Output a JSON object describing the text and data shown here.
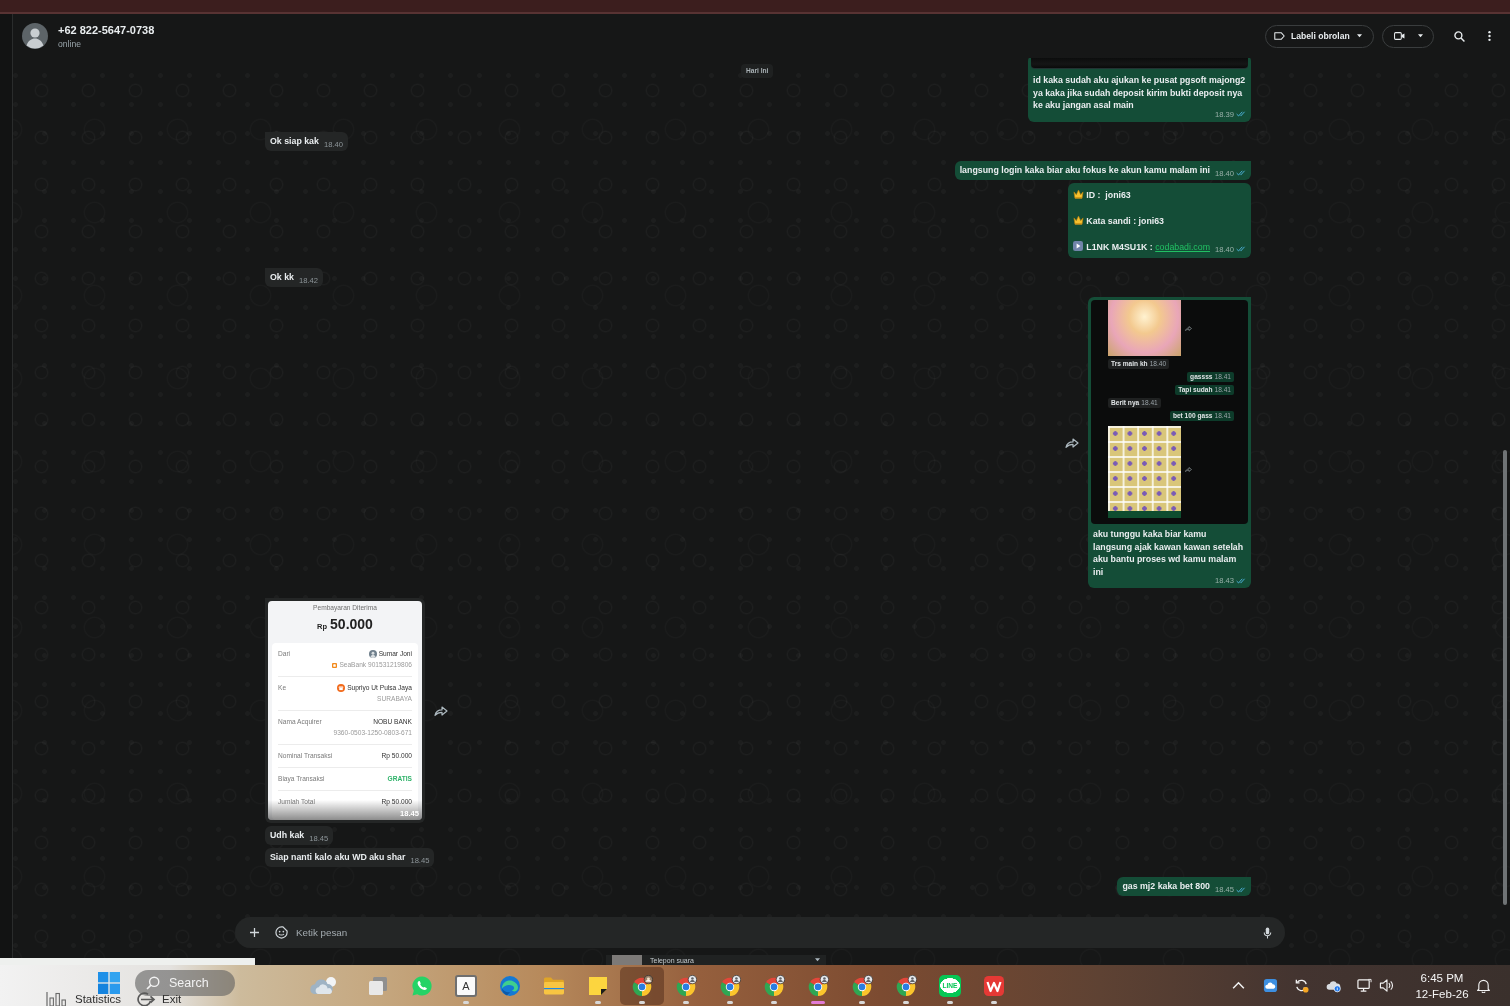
{
  "header": {
    "contact_name": "+62 822-5647-0738",
    "status": "online",
    "label_button": "Labeli obrolan"
  },
  "date_chip": "Hari Ini",
  "messages": [
    {
      "kind": "image_caption",
      "outgoing": true,
      "tail": false,
      "image": {
        "kind": "strip"
      },
      "text": "id kaka sudah aku ajukan ke pusat pgsoft majong2 ya kaka jika sudah deposit kirim bukti deposit nya ke aku jangan asal main",
      "time": "18.39",
      "read": true
    },
    {
      "kind": "text",
      "outgoing": false,
      "tail": true,
      "text": "Ok siap kak",
      "time": "18.40"
    },
    {
      "kind": "text",
      "outgoing": true,
      "tail": true,
      "text": "langsung login kaka biar aku fokus ke akun kamu malam ini",
      "time": "18.40",
      "read": true
    },
    {
      "kind": "lines",
      "outgoing": true,
      "tail": false,
      "lines": [
        {
          "kind": "crown",
          "text": "ID :  joni63"
        },
        {
          "kind": "crown",
          "text": "Kata sandi : joni63"
        },
        {
          "kind": "play",
          "text": "L1NK M4SU1K : ",
          "link": "codabadi.com"
        }
      ],
      "time": "18.40",
      "read": true
    },
    {
      "kind": "text",
      "outgoing": false,
      "tail": true,
      "text": "Ok kk",
      "time": "18.42"
    },
    {
      "kind": "image_caption",
      "outgoing": true,
      "tail": true,
      "image": {
        "kind": "chat_screenshot",
        "items": [
          {
            "kind": "photo"
          },
          {
            "kind": "in",
            "text": "Trs main kh",
            "time": "18.40"
          },
          {
            "kind": "out",
            "text": "gassss",
            "time": "18.41"
          },
          {
            "kind": "out",
            "text": "Tapi sudah",
            "time": "18.41"
          },
          {
            "kind": "in",
            "text": "Berit nya",
            "time": "18.41"
          },
          {
            "kind": "out",
            "text": "bet 100 gass",
            "time": "18.41"
          },
          {
            "kind": "photo"
          }
        ]
      },
      "text": "aku tunggu kaka biar kamu langsung ajak kawan kawan setelah aku bantu proses wd kamu malam ini",
      "time": "18.43",
      "read": true
    },
    {
      "kind": "image",
      "outgoing": false,
      "tail": true,
      "image": {
        "kind": "receipt",
        "title": "Pembayaran Diterima",
        "currency": "Rp",
        "amount": "50.000",
        "rows": [
          {
            "kind": "person",
            "label": "Dari",
            "value": "Sumar Joni",
            "sub": {
              "kind": "bank",
              "text": "SeaBank 901531219806"
            },
            "highlight": false
          },
          {
            "kind": "store",
            "label": "Ke",
            "value": "Supriyo Ut Pulsa Jaya",
            "sub": {
              "kind": "plain",
              "text": "SURABAYA"
            },
            "highlight": false
          },
          {
            "kind": "plain",
            "label": "Nama Acquirer",
            "value": "NOBU BANK",
            "sub": {
              "kind": "plain",
              "text": "9360-0503-1250-0803-671"
            },
            "highlight": false
          },
          {
            "kind": "plain",
            "label": "Nominal Transaksi",
            "value": "Rp 50.000",
            "highlight": false
          },
          {
            "kind": "plain",
            "label": "Biaya Transaksi",
            "value": "GRATIS",
            "highlight": true
          },
          {
            "kind": "plain",
            "label": "Jumlah Total",
            "value": "Rp 50.000",
            "highlight": false
          }
        ]
      },
      "time": "18.45"
    },
    {
      "kind": "text",
      "outgoing": false,
      "tail": false,
      "text": "Udh kak",
      "time": "18.45"
    },
    {
      "kind": "text",
      "outgoing": false,
      "tail": false,
      "text": "Siap nanti kalo aku WD aku shar",
      "time": "18.45"
    },
    {
      "kind": "text",
      "outgoing": true,
      "tail": true,
      "text": "gas mj2 kaka bet 800",
      "time": "18.45",
      "read": true
    }
  ],
  "composer": {
    "placeholder": "Ketik pesan"
  },
  "call_popup": {
    "label": "Telepon suara"
  },
  "taskbar": {
    "search_label": "Search",
    "apps": [
      {
        "kind": "weather",
        "open": false,
        "selected": false,
        "hovered": false
      },
      {
        "kind": "task_view",
        "open": false,
        "selected": false,
        "hovered": false
      },
      {
        "kind": "whatsapp",
        "open": false,
        "selected": false,
        "hovered": false
      },
      {
        "kind": "font",
        "label": "A",
        "open": true,
        "selected": false,
        "hovered": false
      },
      {
        "kind": "edge",
        "open": false,
        "selected": false,
        "hovered": false
      },
      {
        "kind": "folder",
        "open": false,
        "selected": false,
        "hovered": false
      },
      {
        "kind": "notes",
        "open": true,
        "selected": false,
        "hovered": false
      },
      {
        "kind": "chrome_photo",
        "open": true,
        "selected": false,
        "hovered": true
      },
      {
        "kind": "chrome_person",
        "open": true,
        "selected": false,
        "hovered": false
      },
      {
        "kind": "chrome_person",
        "open": true,
        "selected": false,
        "hovered": false
      },
      {
        "kind": "chrome_person",
        "open": true,
        "selected": false,
        "hovered": false
      },
      {
        "kind": "chrome_person",
        "open": true,
        "selected": true,
        "hovered": false
      },
      {
        "kind": "chrome_person",
        "open": true,
        "selected": false,
        "hovered": false
      },
      {
        "kind": "chrome_person",
        "open": true,
        "selected": false,
        "hovered": false
      },
      {
        "kind": "line",
        "label": "LINE",
        "open": true,
        "selected": false,
        "hovered": false
      },
      {
        "kind": "wps",
        "open": true,
        "selected": false,
        "hovered": false
      }
    ],
    "time": "6:45 PM",
    "date": "12-Feb-26"
  },
  "overlay_toolbar": [
    {
      "kind": "chart",
      "label": "Statistics"
    },
    {
      "kind": "exit",
      "label": "Exit"
    }
  ]
}
